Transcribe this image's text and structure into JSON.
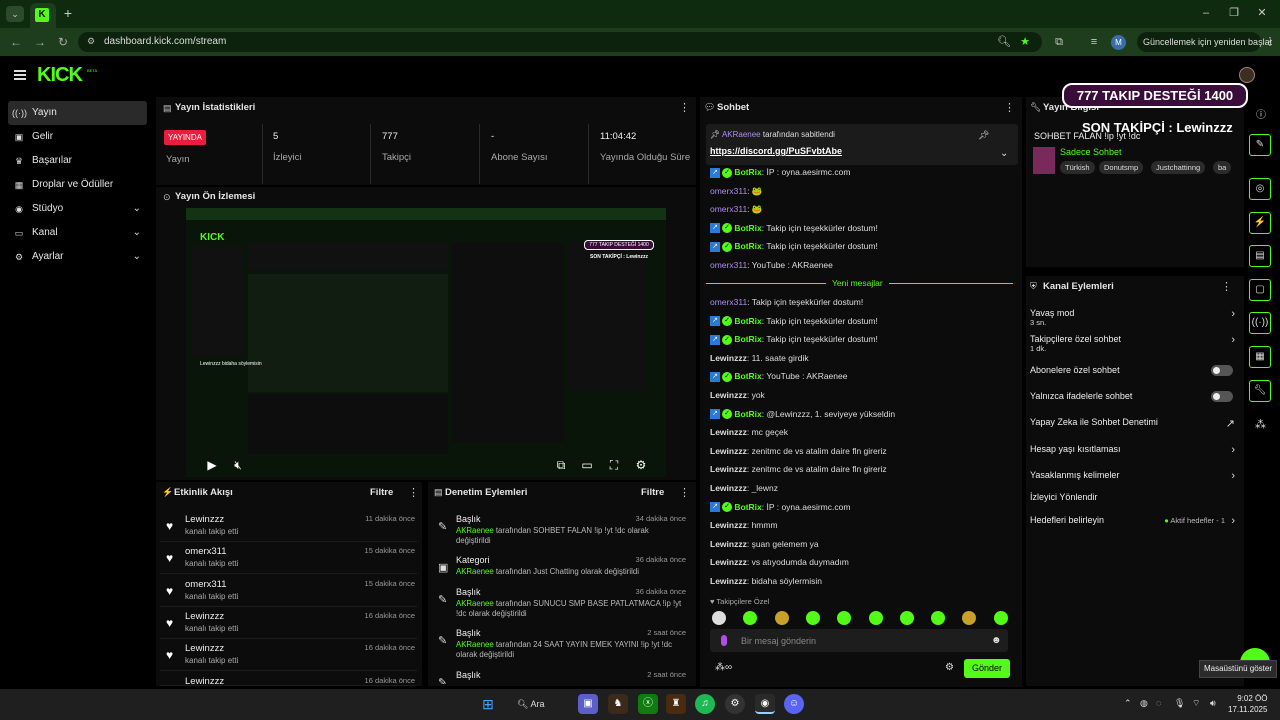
{
  "browser": {
    "tab_caret": "⌄",
    "new_tab": "+",
    "url": "dashboard.kick.com/stream",
    "profile_initial": "M",
    "update_label": "Güncellemek için yeniden başlat",
    "favicon_text": "K"
  },
  "app": {
    "logo": "KICK",
    "logo_beta": "BETA"
  },
  "sidebar": {
    "items": [
      {
        "label": "Yayın",
        "icon": "broadcast-icon"
      },
      {
        "label": "Gelir",
        "icon": "revenue-icon"
      },
      {
        "label": "Başarılar",
        "icon": "trophy-icon"
      },
      {
        "label": "Droplar ve Ödüller",
        "icon": "gift-icon"
      },
      {
        "label": "Stüdyo",
        "icon": "studio-icon"
      },
      {
        "label": "Kanal",
        "icon": "channel-icon"
      },
      {
        "label": "Ayarlar",
        "icon": "gear-icon"
      }
    ]
  },
  "stats": {
    "title": "Yayın İstatistikleri",
    "live_badge": "YAYINDA",
    "cells": [
      {
        "value": "",
        "label": "Yayın"
      },
      {
        "value": "5",
        "label": "İzleyici"
      },
      {
        "value": "777",
        "label": "Takipçi"
      },
      {
        "value": "-",
        "label": "Abone Sayısı"
      },
      {
        "value": "11:04:42",
        "label": "Yayında Olduğu Süre"
      }
    ]
  },
  "preview": {
    "title": "Yayın Ön İzlemesi",
    "inner_overlay_1": "777  TAKIP DESTEĞİ 1400",
    "inner_overlay_2": "SON TAKİPÇİ : Lewinzzz",
    "inner_caption": "Lewinzzz bidaha söylemisin"
  },
  "activity": {
    "title": "Etkinlik Akışı",
    "filter": "Filtre",
    "rows": [
      {
        "name": "Lewinzzz",
        "sub": "kanalı takip etti",
        "time": "11 dakika önce"
      },
      {
        "name": "omerx311",
        "sub": "kanalı takip etti",
        "time": "15 dakika önce"
      },
      {
        "name": "omerx311",
        "sub": "kanalı takip etti",
        "time": "15 dakika önce"
      },
      {
        "name": "Lewinzzz",
        "sub": "kanalı takip etti",
        "time": "16 dakika önce"
      },
      {
        "name": "Lewinzzz",
        "sub": "kanalı takip etti",
        "time": "16 dakika önce"
      },
      {
        "name": "Lewinzzz",
        "sub": "",
        "time": "16 dakika önce"
      }
    ]
  },
  "moderation": {
    "title": "Denetim Eylemleri",
    "filter": "Filtre",
    "rows": [
      {
        "title": "Başlık",
        "user": "AKRaenee",
        "mid": " tarafından ",
        "value": "SOHBET FALAN !ip !yt !dc",
        "end": " olarak değiştirildi",
        "time": "34 dakika önce"
      },
      {
        "title": "Kategori",
        "user": "AKRaenee",
        "mid": " tarafından ",
        "value": "Just Chatting",
        "end": " olarak değiştirildi",
        "time": "36 dakika önce"
      },
      {
        "title": "Başlık",
        "user": "AKRaenee",
        "mid": " tarafından ",
        "value": "SUNUCU SMP BASE PATLATMACA !ip !yt !dc",
        "end": " olarak değiştirildi",
        "time": "36 dakika önce"
      },
      {
        "title": "Başlık",
        "user": "AKRaenee",
        "mid": " tarafından ",
        "value": "24 SAAT YAYIN EMEK YAYINI !ip !yt !dc",
        "end": " olarak değiştirildi",
        "time": "2 saat önce"
      },
      {
        "title": "Başlık",
        "user": "",
        "mid": "",
        "value": "",
        "end": "",
        "time": "2 saat önce"
      }
    ]
  },
  "chat": {
    "title": "Sohbet",
    "pinned_user": "AKRaenee",
    "pinned_by": " tarafından sabitlendi",
    "pinned_link": "https://discord.gg/PuSFvbtAbe",
    "new_messages": "Yeni mesajlar",
    "messages_top": [
      {
        "user": "BotRix",
        "type": "bot",
        "text": "İP : oyna.aesirmc.com"
      },
      {
        "user": "omerx311",
        "type": "om",
        "text": "🐸"
      },
      {
        "user": "omerx311",
        "type": "om",
        "text": "🐸"
      },
      {
        "user": "BotRix",
        "type": "bot",
        "text": "Takip için teşekkürler dostum!"
      },
      {
        "user": "BotRix",
        "type": "bot",
        "text": "Takip için teşekkürler dostum!"
      },
      {
        "user": "omerx311",
        "type": "om",
        "text": "YouTube : AKRaenee"
      }
    ],
    "messages_bottom": [
      {
        "user": "omerx311",
        "type": "om",
        "text": "Takip için teşekkürler dostum!"
      },
      {
        "user": "BotRix",
        "type": "bot",
        "text": "Takip için teşekkürler dostum!"
      },
      {
        "user": "BotRix",
        "type": "bot",
        "text": "Takip için teşekkürler dostum!"
      },
      {
        "user": "Lewinzzz",
        "type": "lw",
        "text": "11. saate girdik"
      },
      {
        "user": "BotRix",
        "type": "bot",
        "text": "YouTube : AKRaenee"
      },
      {
        "user": "Lewinzzz",
        "type": "lw",
        "text": "yok"
      },
      {
        "user": "BotRix",
        "type": "bot",
        "text": "@Lewinzzz, 1. seviyeye yükseldin"
      },
      {
        "user": "Lewinzzz",
        "type": "lw",
        "text": "mc geçek"
      },
      {
        "user": "Lewinzzz",
        "type": "lw",
        "text": "zenitmc de vs atalim daire fln gireriz"
      },
      {
        "user": "Lewinzzz",
        "type": "lw",
        "text": "zenitmc de vs atalim daire fln gireriz"
      },
      {
        "user": "Lewinzzz",
        "type": "lw",
        "text": "_lewnz"
      },
      {
        "user": "BotRix",
        "type": "bot",
        "text": "İP : oyna.aesirmc.com"
      },
      {
        "user": "Lewinzzz",
        "type": "lw",
        "text": "hmmm"
      },
      {
        "user": "Lewinzzz",
        "type": "lw",
        "text": "şuan gelemem ya"
      },
      {
        "user": "Lewinzzz",
        "type": "lw",
        "text": "vs atıyodumda duymadım"
      },
      {
        "user": "Lewinzzz",
        "type": "lw",
        "text": "bidaha söylermisin"
      }
    ],
    "emote_label": "Takipçilere Özel",
    "input_placeholder": "Bir mesaj gönderin",
    "send": "Gönder"
  },
  "stream_info": {
    "title": "Yayın Bilgisi",
    "stream_title": "SOHBET FALAN !ip !yt !dc",
    "category": "Sadece Sohbet",
    "tags": [
      "Türkish",
      "Donutsmp",
      "Justchattinng",
      "ba"
    ]
  },
  "overlay": {
    "box": "777  TAKIP DESTEĞİ 1400",
    "sub": "SON TAKİPÇİ : Lewinzzz"
  },
  "channel_actions": {
    "title": "Kanal Eylemleri",
    "rows": [
      {
        "label": "Yavaş mod",
        "sub": "3 sn.",
        "control": "chevron"
      },
      {
        "label": "Takipçilere özel sohbet",
        "sub": "1 dk.",
        "control": "chevron"
      },
      {
        "label": "Abonelere özel sohbet",
        "sub": "",
        "control": "toggle"
      },
      {
        "label": "Yalnızca ifadelerle sohbet",
        "sub": "",
        "control": "toggle"
      },
      {
        "label": "Yapay Zeka ile Sohbet Denetimi",
        "sub": "",
        "control": "external"
      },
      {
        "label": "Hesap yaşı kısıtlaması",
        "sub": "",
        "control": "chevron"
      },
      {
        "label": "Yasaklanmış kelimeler",
        "sub": "",
        "control": "chevron"
      },
      {
        "label": "İzleyici Yönlendir",
        "sub": "",
        "control": "none"
      },
      {
        "label": "Hedefleri belirleyin",
        "sub": "",
        "control": "goal"
      }
    ],
    "goal_status": "Aktif hedefler - 1"
  },
  "taskbar": {
    "search": "Ara",
    "time": "9:02 ÖÖ",
    "date": "17.11.2025",
    "tooltip": "Masaüstünü göster"
  },
  "colors": {
    "accent": "#53fc18",
    "live": "#e91e3c",
    "bot_badge": "#2a7ad8"
  }
}
